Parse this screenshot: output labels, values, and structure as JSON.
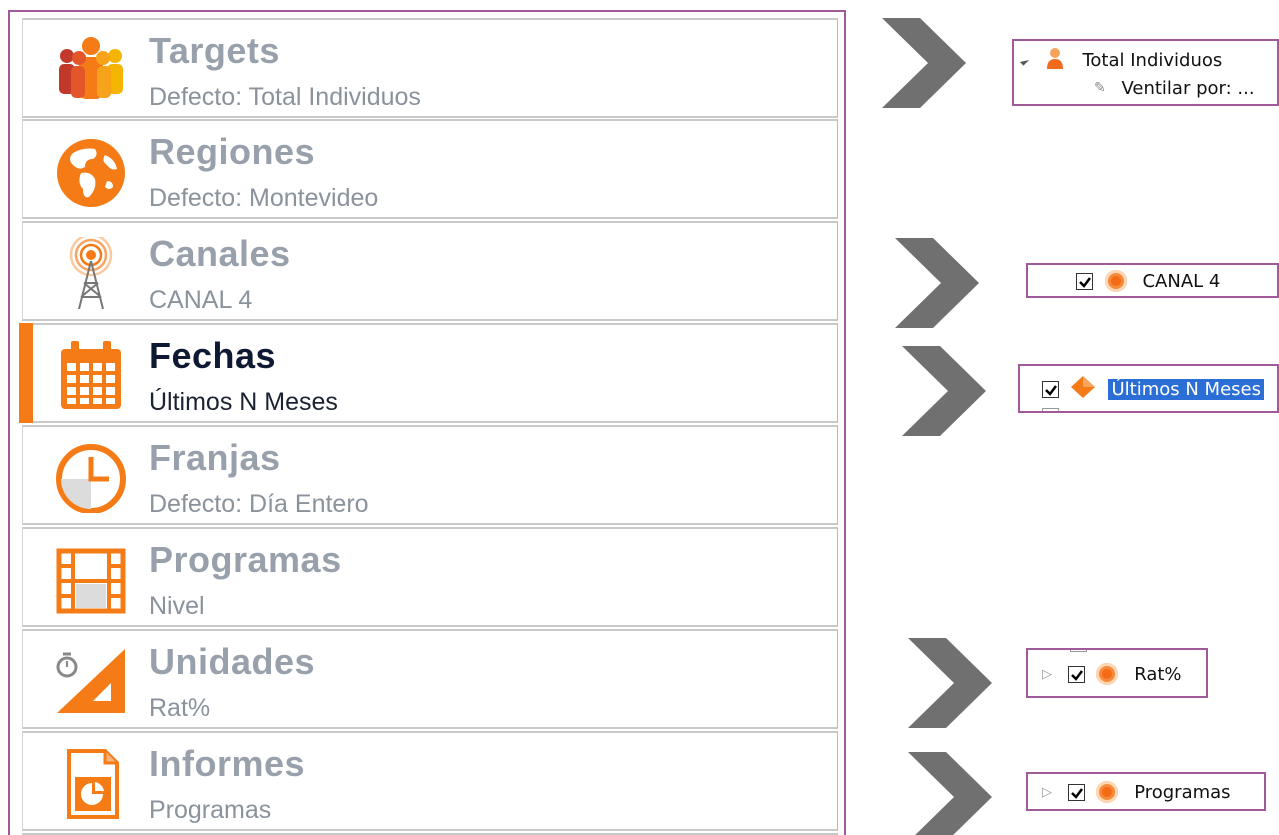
{
  "nav": {
    "items": [
      {
        "title": "Targets",
        "subtitle": "Defecto: Total Individuos",
        "icon": "people-icon"
      },
      {
        "title": "Regiones",
        "subtitle": "Defecto: Montevideo",
        "icon": "globe-icon"
      },
      {
        "title": "Canales",
        "subtitle": "CANAL 4",
        "icon": "antenna-icon"
      },
      {
        "title": "Fechas",
        "subtitle": "Últimos N Meses",
        "icon": "calendar-icon",
        "active": true
      },
      {
        "title": "Franjas",
        "subtitle": "Defecto: Día Entero",
        "icon": "clock-icon"
      },
      {
        "title": "Programas",
        "subtitle": "Nivel",
        "icon": "film-icon"
      },
      {
        "title": "Unidades",
        "subtitle": "Rat%",
        "icon": "ruler-stopwatch-icon"
      },
      {
        "title": "Informes",
        "subtitle": "Programas",
        "icon": "report-chart-icon"
      }
    ]
  },
  "callouts": {
    "targets": {
      "label": "Total Individuos",
      "child_label": "Ventilar por: ..."
    },
    "canales": {
      "label": "CANAL 4"
    },
    "fechas": {
      "label": "Últimos N Meses"
    },
    "unidades": {
      "label": "Rat%"
    },
    "informes": {
      "label": "Programas"
    }
  },
  "colors": {
    "accent": "#f47b16",
    "frame": "#a05a9a",
    "arrow": "#707070",
    "title_inactive": "#97a0ab",
    "title_active": "#0e1a33"
  }
}
